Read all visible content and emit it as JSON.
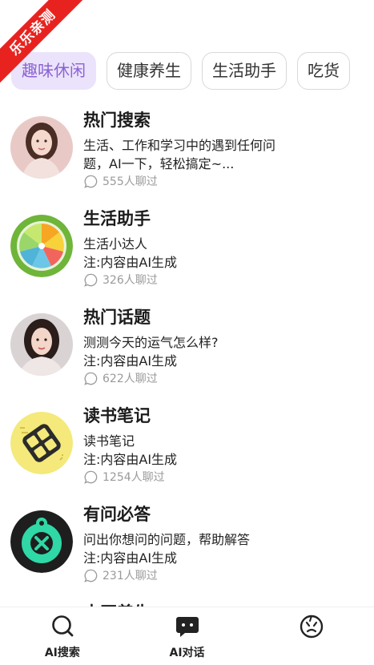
{
  "ribbon": {
    "text": "乐乐亲测"
  },
  "tabs": [
    {
      "label": "趣味休闲",
      "active": true
    },
    {
      "label": "健康养生",
      "active": false
    },
    {
      "label": "生活助手",
      "active": false
    },
    {
      "label": "吃货",
      "active": false
    }
  ],
  "items": [
    {
      "title": "热门搜索",
      "line1": "生活、工作和学习中的遇到任何问",
      "line2": "题，AI一下，轻松搞定~...",
      "chats": "555人聊过",
      "icon": "woman-portrait-avatar"
    },
    {
      "title": "生活助手",
      "line1": "生活小达人",
      "line2": "注:内容由AI生成",
      "chats": "326人聊过",
      "icon": "citrus-slice-avatar"
    },
    {
      "title": "热门话题",
      "line1": "测测今天的运气怎么样?",
      "line2": "注:内容由AI生成",
      "chats": "622人聊过",
      "icon": "woman-portrait-avatar"
    },
    {
      "title": "读书笔记",
      "line1": "读书笔记",
      "line2": "注:内容由AI生成",
      "chats": "1254人聊过",
      "icon": "sticky-note-avatar"
    },
    {
      "title": "有问必答",
      "line1": "问出你想问的问题，帮助解答",
      "line2": "注:内容由AI生成",
      "chats": "231人聊过",
      "icon": "robot-face-avatar"
    },
    {
      "title": "中医养生",
      "line1": "",
      "line2": "",
      "chats": "",
      "icon": ""
    }
  ],
  "bottom_nav": [
    {
      "label": "AI搜索",
      "icon": "search-icon"
    },
    {
      "label": "AI对话",
      "icon": "chat-bubble-icon"
    },
    {
      "label": "",
      "icon": "face-doodle-icon"
    }
  ],
  "colors": {
    "accent": "#8a63d2",
    "tab_active_bg": "#ebe3fb",
    "ribbon": "#e8231f"
  }
}
